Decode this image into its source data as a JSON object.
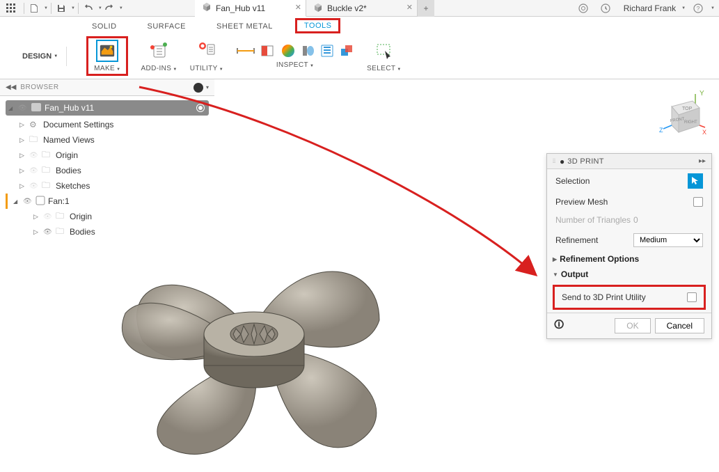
{
  "topbar": {
    "tabs": [
      {
        "name": "Fan_Hub v11",
        "active": true
      },
      {
        "name": "Buckle v2*",
        "active": false
      }
    ],
    "user": "Richard Frank"
  },
  "ribbon_tabs": {
    "solid": "SOLID",
    "surface": "SURFACE",
    "sheet_metal": "SHEET METAL",
    "tools": "TOOLS"
  },
  "ribbon": {
    "design": "DESIGN",
    "make": "MAKE",
    "addins": "ADD-INS",
    "utility": "UTILITY",
    "inspect": "INSPECT",
    "select": "SELECT"
  },
  "browser": {
    "title": "BROWSER",
    "root": "Fan_Hub v11",
    "items": {
      "doc_settings": "Document Settings",
      "named_views": "Named Views",
      "origin": "Origin",
      "bodies": "Bodies",
      "sketches": "Sketches",
      "fan_component": "Fan:1",
      "fan_origin": "Origin",
      "fan_bodies": "Bodies"
    }
  },
  "panel": {
    "title": "3D PRINT",
    "selection_label": "Selection",
    "preview_mesh_label": "Preview Mesh",
    "num_triangles_label": "Number of Triangles",
    "num_triangles_value": "0",
    "refinement_label": "Refinement",
    "refinement_value": "Medium",
    "refinement_options": "Refinement Options",
    "output": "Output",
    "send_to_utility": "Send to 3D Print Utility",
    "ok": "OK",
    "cancel": "Cancel"
  },
  "viewcube": {
    "top": "TOP",
    "front": "FRONT",
    "right": "RIGHT"
  }
}
